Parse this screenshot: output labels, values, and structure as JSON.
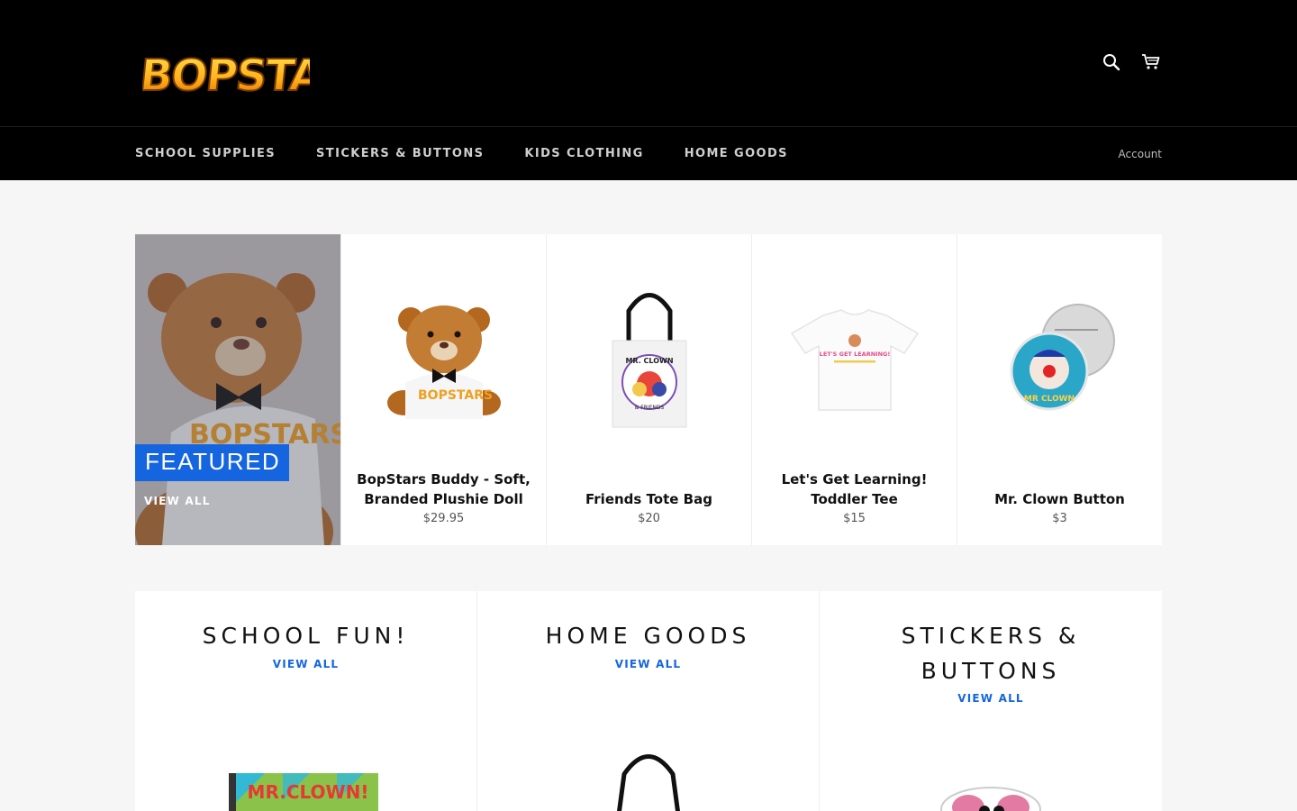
{
  "brand": {
    "logo_text": "BOPSTARS"
  },
  "header": {
    "search_icon": "search-icon",
    "cart_icon": "cart-icon"
  },
  "nav": {
    "links": [
      "SCHOOL SUPPLIES",
      "STICKERS & BUTTONS",
      "KIDS CLOTHING",
      "HOME GOODS"
    ],
    "account_label": "Account"
  },
  "featured": {
    "tag": "FEATURED",
    "view_all": "VIEW ALL",
    "products": [
      {
        "title": "BopStars Buddy - Soft, Branded Plushie Doll",
        "price": "$29.95"
      },
      {
        "title": "Friends Tote Bag",
        "price": "$20"
      },
      {
        "title": "Let's Get Learning! Toddler Tee",
        "price": "$15"
      },
      {
        "title": "Mr. Clown Button",
        "price": "$3"
      }
    ]
  },
  "collections": [
    {
      "title": "SCHOOL FUN!",
      "view_all": "VIEW ALL",
      "image_text": "MR.CLOWN!"
    },
    {
      "title": "HOME GOODS",
      "view_all": "VIEW ALL"
    },
    {
      "title": "STICKERS & BUTTONS",
      "view_all": "VIEW ALL"
    }
  ],
  "product_image_text": {
    "tote": "MR. CLOWN",
    "tote_sub": "& FRIENDS",
    "tee": "LET'S GET LEARNING!",
    "button": "MR CLOWN"
  },
  "colors": {
    "accent": "#1565e0",
    "header_bg": "#000000",
    "page_bg": "#f6f6f6"
  }
}
